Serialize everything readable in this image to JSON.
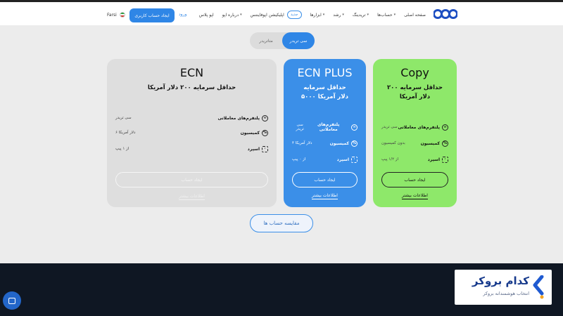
{
  "header": {
    "nav": [
      {
        "label": "صفحه اصلی",
        "dropdown": false
      },
      {
        "label": "حساب‌ها",
        "dropdown": true
      },
      {
        "label": "تریدینگ",
        "dropdown": true
      },
      {
        "label": "رشد",
        "dropdown": true
      },
      {
        "label": "ابزارها",
        "dropdown": true
      },
      {
        "label": "اپلیکیشن اپوفایننس",
        "dropdown": false,
        "badge": "جدید"
      },
      {
        "label": "درباره اپو",
        "dropdown": true
      },
      {
        "label": "اپو پلاس",
        "dropdown": false
      }
    ],
    "login": "ورود",
    "create_account": "ایجاد حساب کاربری",
    "language": "Farsi"
  },
  "toggle": {
    "left": "متاتریدر",
    "right": "سی تریدر",
    "selected": "right"
  },
  "cards": {
    "ecn": {
      "title": "ECN",
      "subtitle": "حداقل سرمایه ۲۰۰ دلار آمریکا",
      "rows": [
        {
          "label": "پلتفرم‌های معاملاتی",
          "value": "سی تریدر"
        },
        {
          "label": "کمیسیون",
          "value": "۶ دلار آمریکا"
        },
        {
          "label": "اسپرد",
          "value": "از ۱ پیپ"
        }
      ],
      "cta": "ایجاد حساب",
      "more": "اطلاعات بیشتر"
    },
    "plus": {
      "title": "ECN PLUS",
      "subtitle_line1": "حداقل سرمایه",
      "subtitle_line2": "۵۰۰۰ دلار آمریکا",
      "rows": [
        {
          "label": "پلتفرم‌های معاملاتی",
          "value": "سی تریدر"
        },
        {
          "label": "کمیسیون",
          "value": "۴ دلار آمریکا"
        },
        {
          "label": "اسپرد",
          "value": "از ۰ پیپ"
        }
      ],
      "cta": "ایجاد حساب",
      "more": "اطلاعات بیشتر"
    },
    "copy": {
      "title": "Copy",
      "subtitle_line1": "حداقل سرمایه ۲۰۰",
      "subtitle_line2": "دلار آمریکا",
      "rows": [
        {
          "label": "پلتفرم‌های معاملاتی",
          "value": "سی تریدر"
        },
        {
          "label": "کمیسیون",
          "value": "بدون کمیسیون"
        },
        {
          "label": "اسپرد",
          "value": "از ۱/۲ پیپ"
        }
      ],
      "cta": "ایجاد حساب",
      "more": "اطلاعات بیشتر"
    }
  },
  "compare_button": "مقایسه حساب ها",
  "watermark": {
    "name": "کدام بروکر",
    "tagline": "انتخاب هوشمندانه بروکر"
  },
  "colors": {
    "accent": "#2f86e6",
    "plus_card": "#3b8fe8",
    "copy_card": "#8ee86a",
    "ecn_card": "#dedede",
    "footer": "#0f1723"
  }
}
